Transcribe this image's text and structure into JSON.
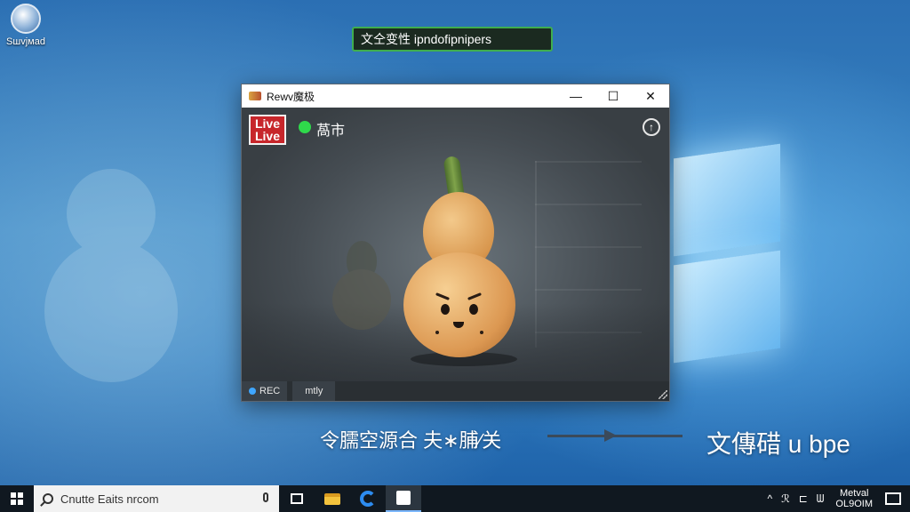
{
  "desktop": {
    "icon_label": "Sшvjмad"
  },
  "notification": {
    "text": "文仝变性 ipndofipnipers"
  },
  "window": {
    "title": "Rewv魔极",
    "controls": {
      "minimize": "—",
      "maximize": "☐",
      "close": "✕"
    },
    "live_badge": [
      "Live",
      "Live"
    ],
    "status_text": "萵市",
    "status_color": "#2fd94b",
    "corner_icon": "↑",
    "statusbar": {
      "rec": "REC",
      "tag": "mtly"
    }
  },
  "captions": {
    "left": "令臑空源合 夫∗脯∕关",
    "right": "文傳碏 u bpe"
  },
  "taskbar": {
    "search_placeholder": "Cnutte Eaits nrcom",
    "tray": {
      "up_arrow": "^",
      "icons": [
        "ℛ",
        "⊏",
        "ᗯ"
      ],
      "time": "Metval",
      "date": "ОL9OIM"
    }
  },
  "colors": {
    "accent": "#2d8cf0",
    "live_red": "#c7262b",
    "notif_border": "#3fae4e"
  }
}
